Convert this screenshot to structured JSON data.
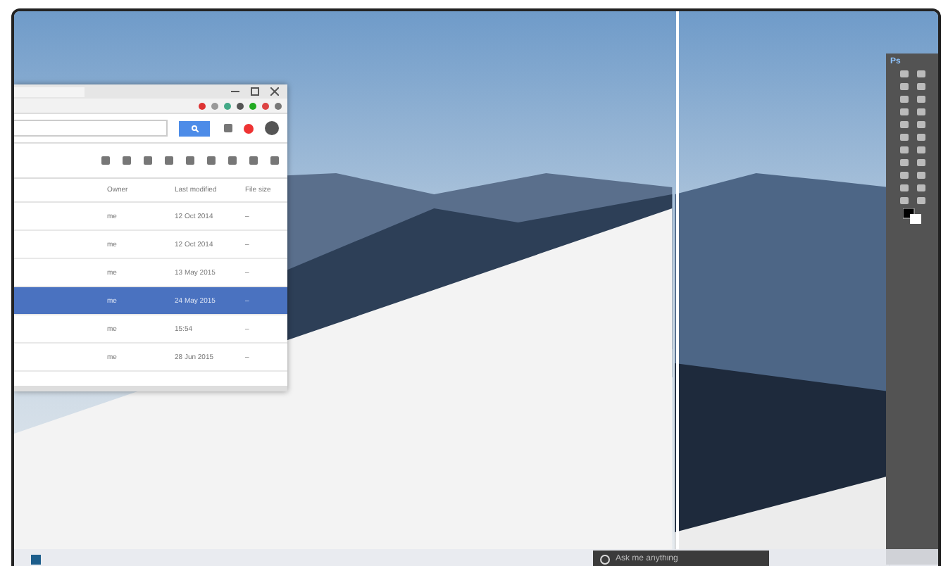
{
  "drive": {
    "columns": [
      "Owner",
      "Last modified",
      "File size"
    ],
    "rows": [
      {
        "owner": "me",
        "modified": "12 Oct 2014",
        "size": "–",
        "selected": false
      },
      {
        "owner": "me",
        "modified": "12 Oct 2014",
        "size": "–",
        "selected": false
      },
      {
        "owner": "me",
        "modified": "13 May 2015",
        "size": "–",
        "selected": false
      },
      {
        "owner": "me",
        "modified": "24 May 2015",
        "size": "–",
        "selected": true
      },
      {
        "owner": "me",
        "modified": "15:54",
        "size": "–",
        "selected": false
      },
      {
        "owner": "me",
        "modified": "28 Jun 2015",
        "size": "–",
        "selected": false
      }
    ]
  },
  "photoshop": {
    "logo": "Ps"
  },
  "taskbar": {
    "search": {
      "placeholder": "Ask me anything"
    }
  }
}
